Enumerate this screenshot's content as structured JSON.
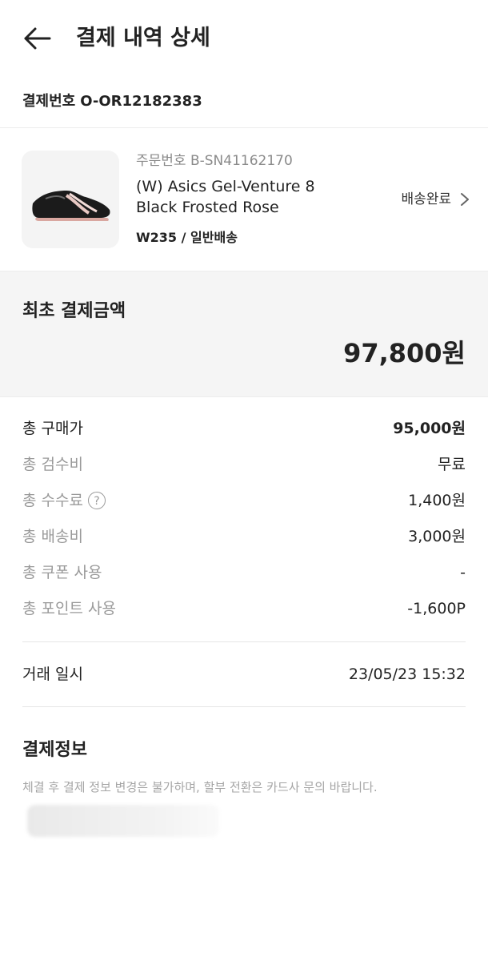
{
  "header": {
    "title": "결제 내역 상세"
  },
  "payment_number": {
    "label": "결제번호",
    "value": "O-OR12182383"
  },
  "product": {
    "order_number": "주문번호 B-SN41162170",
    "name_line1": "(W) Asics Gel-Venture 8",
    "name_line2": "Black Frosted Rose",
    "size_shipping": "W235 / 일반배송",
    "status": "배송완료"
  },
  "total": {
    "label": "최초 결제금액",
    "amount": "97,800원"
  },
  "breakdown": [
    {
      "label": "총 구매가",
      "value": "95,000원"
    },
    {
      "label": "총 검수비",
      "value": "무료"
    },
    {
      "label": "총 수수료",
      "value": "1,400원",
      "help": "?"
    },
    {
      "label": "총 배송비",
      "value": "3,000원"
    },
    {
      "label": "총 쿠폰 사용",
      "value": "-"
    },
    {
      "label": "총 포인트 사용",
      "value": "-1,600P"
    }
  ],
  "trade": {
    "label": "거래 일시",
    "value": "23/05/23 15:32"
  },
  "payment_info": {
    "title": "결제정보",
    "note": "체결 후 결제 정보 변경은 불가하며, 할부 전환은 카드사 문의 바랍니다."
  },
  "icons": {
    "back": "arrow-left-icon",
    "status": "chevron-right-icon",
    "help": "question-circle-icon"
  }
}
